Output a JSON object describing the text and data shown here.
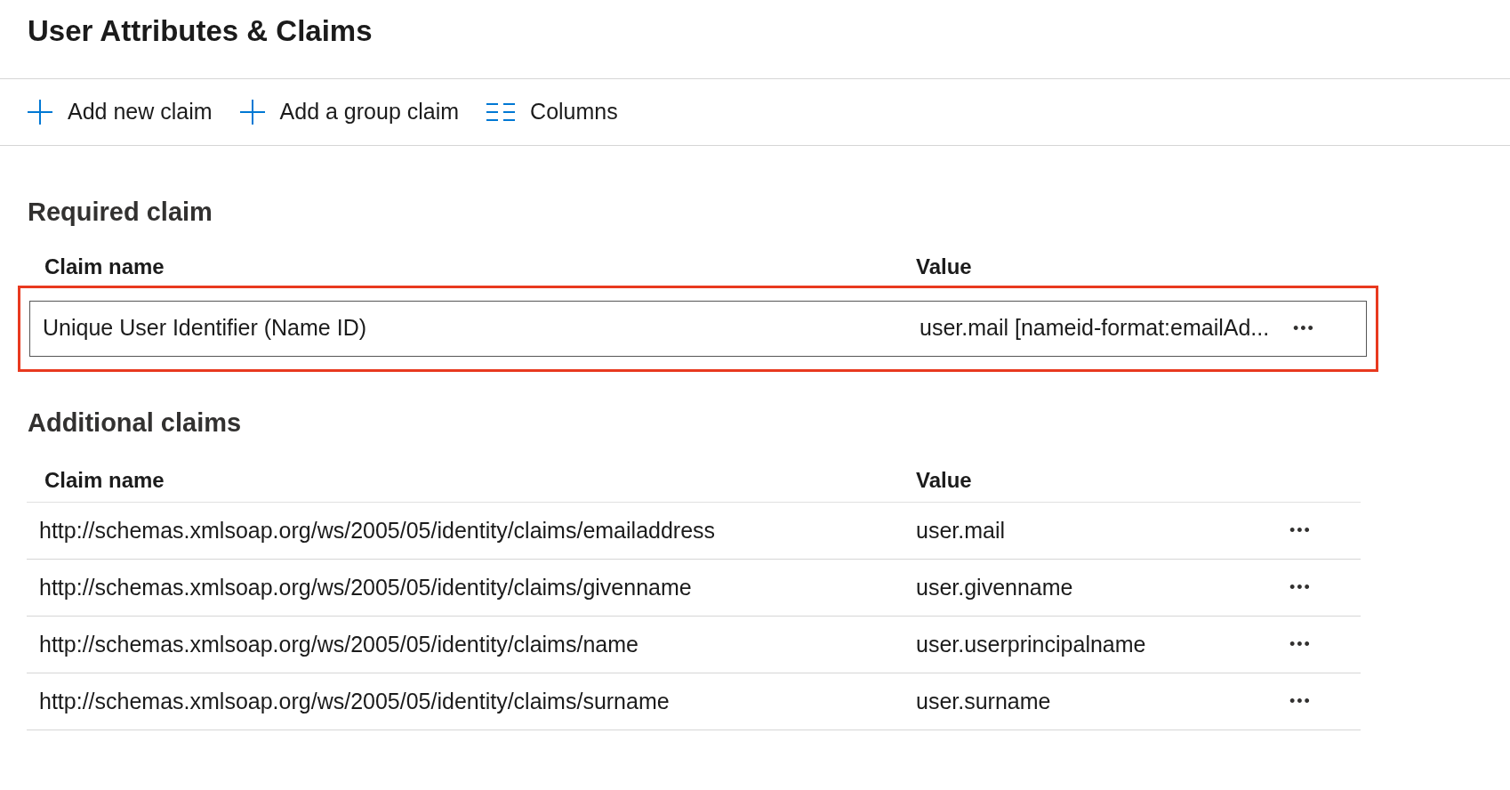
{
  "page": {
    "title": "User Attributes & Claims"
  },
  "toolbar": [
    {
      "kind": "add",
      "label": "Add new claim"
    },
    {
      "kind": "add",
      "label": "Add a group claim"
    },
    {
      "kind": "columns",
      "label": "Columns"
    }
  ],
  "required_claim": {
    "heading": "Required claim",
    "columns": [
      "Claim name",
      "Value"
    ],
    "highlighted": true,
    "rows": [
      {
        "name": "Unique User Identifier (Name ID)",
        "value": "user.mail [nameid-format:emailAd...",
        "more": "•••",
        "focused": true
      }
    ]
  },
  "additional_claims": {
    "heading": "Additional claims",
    "columns": [
      "Claim name",
      "Value"
    ],
    "rows": [
      {
        "name": "http://schemas.xmlsoap.org/ws/2005/05/identity/claims/emailaddress",
        "value": "user.mail",
        "more": "•••",
        "focused": false
      },
      {
        "name": "http://schemas.xmlsoap.org/ws/2005/05/identity/claims/givenname",
        "value": "user.givenname",
        "more": "•••",
        "focused": false
      },
      {
        "name": "http://schemas.xmlsoap.org/ws/2005/05/identity/claims/name",
        "value": "user.userprincipalname",
        "more": "•••",
        "focused": false
      },
      {
        "name": "http://schemas.xmlsoap.org/ws/2005/05/identity/claims/surname",
        "value": "user.surname",
        "more": "•••",
        "focused": false
      }
    ]
  }
}
